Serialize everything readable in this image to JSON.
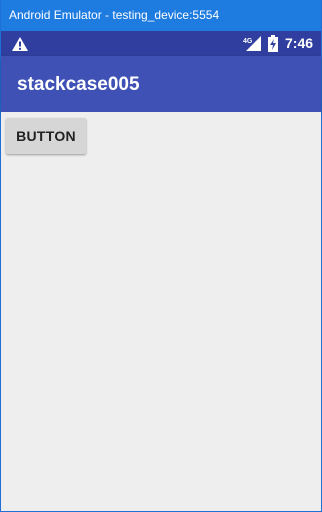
{
  "window": {
    "title": "Android Emulator - testing_device:5554"
  },
  "status_bar": {
    "icons": [
      "warning-icon",
      "signal-4g-icon",
      "battery-icon"
    ],
    "network_label": "4G",
    "time": "7:46"
  },
  "app_bar": {
    "title": "stackcase005"
  },
  "content": {
    "button_label": "BUTTON"
  },
  "colors": {
    "window_titlebar": "#1e7be0",
    "status_bar": "#303f9f",
    "app_bar": "#3f51b5",
    "background": "#eeeeee",
    "button": "#d6d6d6"
  }
}
